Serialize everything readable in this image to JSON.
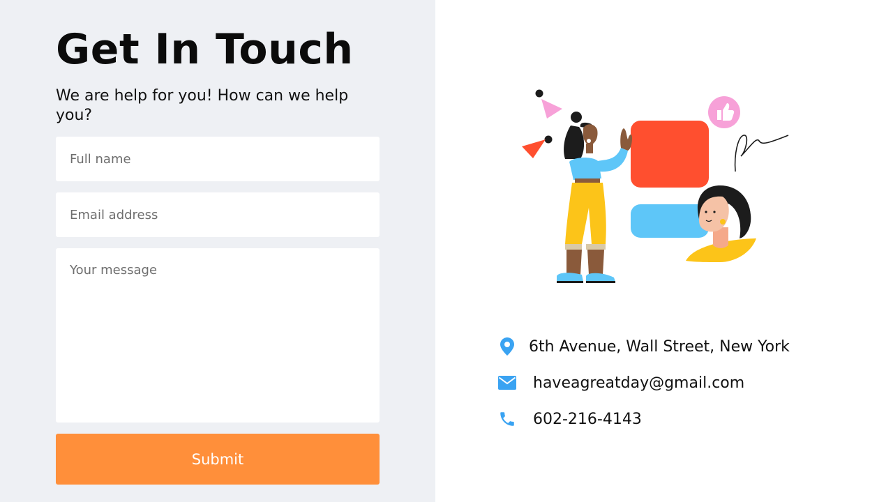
{
  "form": {
    "title": "Get In Touch",
    "subtitle": "We are help for you! How can we help you?",
    "name_placeholder": "Full name",
    "email_placeholder": "Email address",
    "message_placeholder": "Your message",
    "submit_label": "Submit"
  },
  "contact": {
    "address": "6th Avenue, Wall Street, New York",
    "email": "haveagreatday@gmail.com",
    "phone": "602-216-4143"
  },
  "icons": {
    "address": "location-pin-icon",
    "email": "envelope-icon",
    "phone": "phone-icon"
  },
  "colors": {
    "accent": "#ff8f3a",
    "icon": "#3aa3f2",
    "panel": "#eef0f4"
  }
}
